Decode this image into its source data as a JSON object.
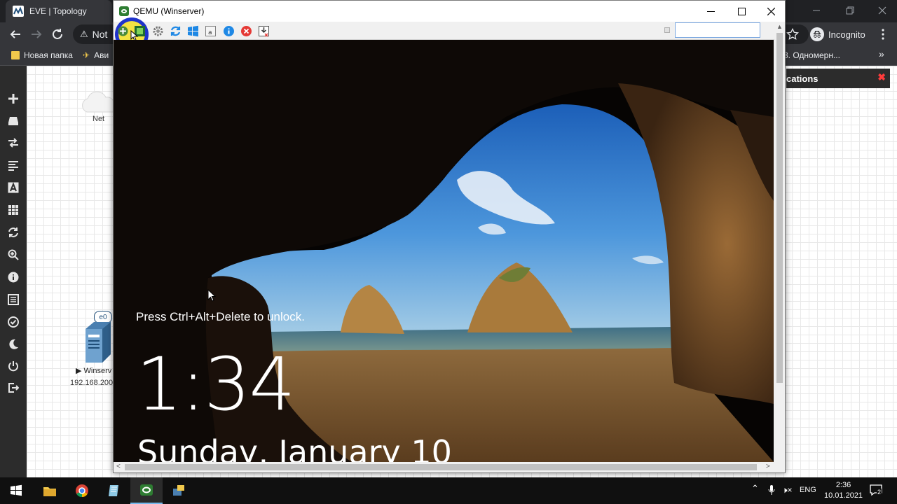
{
  "browser": {
    "tab_title": "EVE | Topology",
    "address_text": "Not",
    "profile_label": "Incognito",
    "bookmarks": [
      "Новая папка",
      "Ави"
    ],
    "bookmark_right": "8. Одномерн..."
  },
  "eve": {
    "cloud_label": "Net",
    "node_port": "e0",
    "node_label": "Winserv",
    "node_ip": "192.168.200",
    "notifications_title": "cations"
  },
  "qemu": {
    "title": "QEMU (Winserver)",
    "search_value": ""
  },
  "lockscreen": {
    "message": "Press Ctrl+Alt+Delete to unlock.",
    "time": "1:34",
    "date": "Sunday, January 10"
  },
  "taskbar": {
    "language": "ENG",
    "time": "2:36",
    "date": "10.01.2021",
    "notification_count": "2"
  },
  "colors": {
    "highlight_yellow": "#f4e23a",
    "highlight_blue": "#1429c8",
    "eve_sidebar": "#2c2c2c"
  }
}
